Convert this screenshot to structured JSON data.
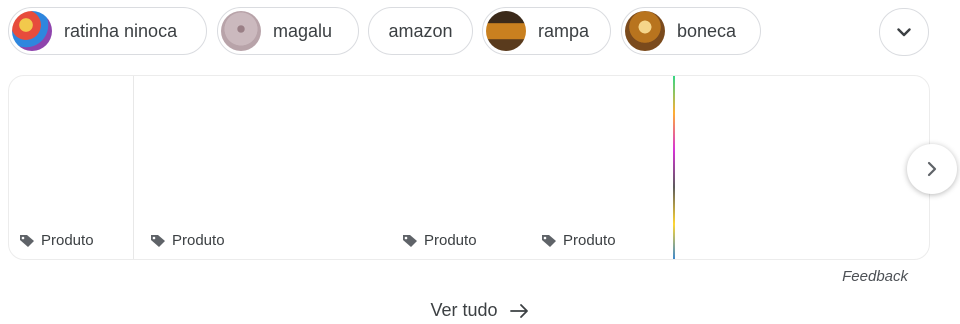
{
  "chips": [
    {
      "label": "ratinha ninoca",
      "thumb": "ratinha-thumb-icon"
    },
    {
      "label": "magalu",
      "thumb": "magalu-thumb-icon"
    },
    {
      "label": "amazon",
      "thumb": ""
    },
    {
      "label": "rampa",
      "thumb": "rampa-thumb-icon"
    },
    {
      "label": "boneca",
      "thumb": "boneca-thumb-icon"
    }
  ],
  "expand_icon": "chevron-down-icon",
  "cards": [
    {
      "tag": "Produto"
    },
    {
      "tag": "Produto"
    },
    {
      "tag": "Produto"
    },
    {
      "tag": "Produto"
    }
  ],
  "next_icon": "chevron-right-icon",
  "feedback": "Feedback",
  "see_all": "Ver tudo",
  "colors": {
    "border": "#dadce0",
    "text": "#3c4043"
  }
}
